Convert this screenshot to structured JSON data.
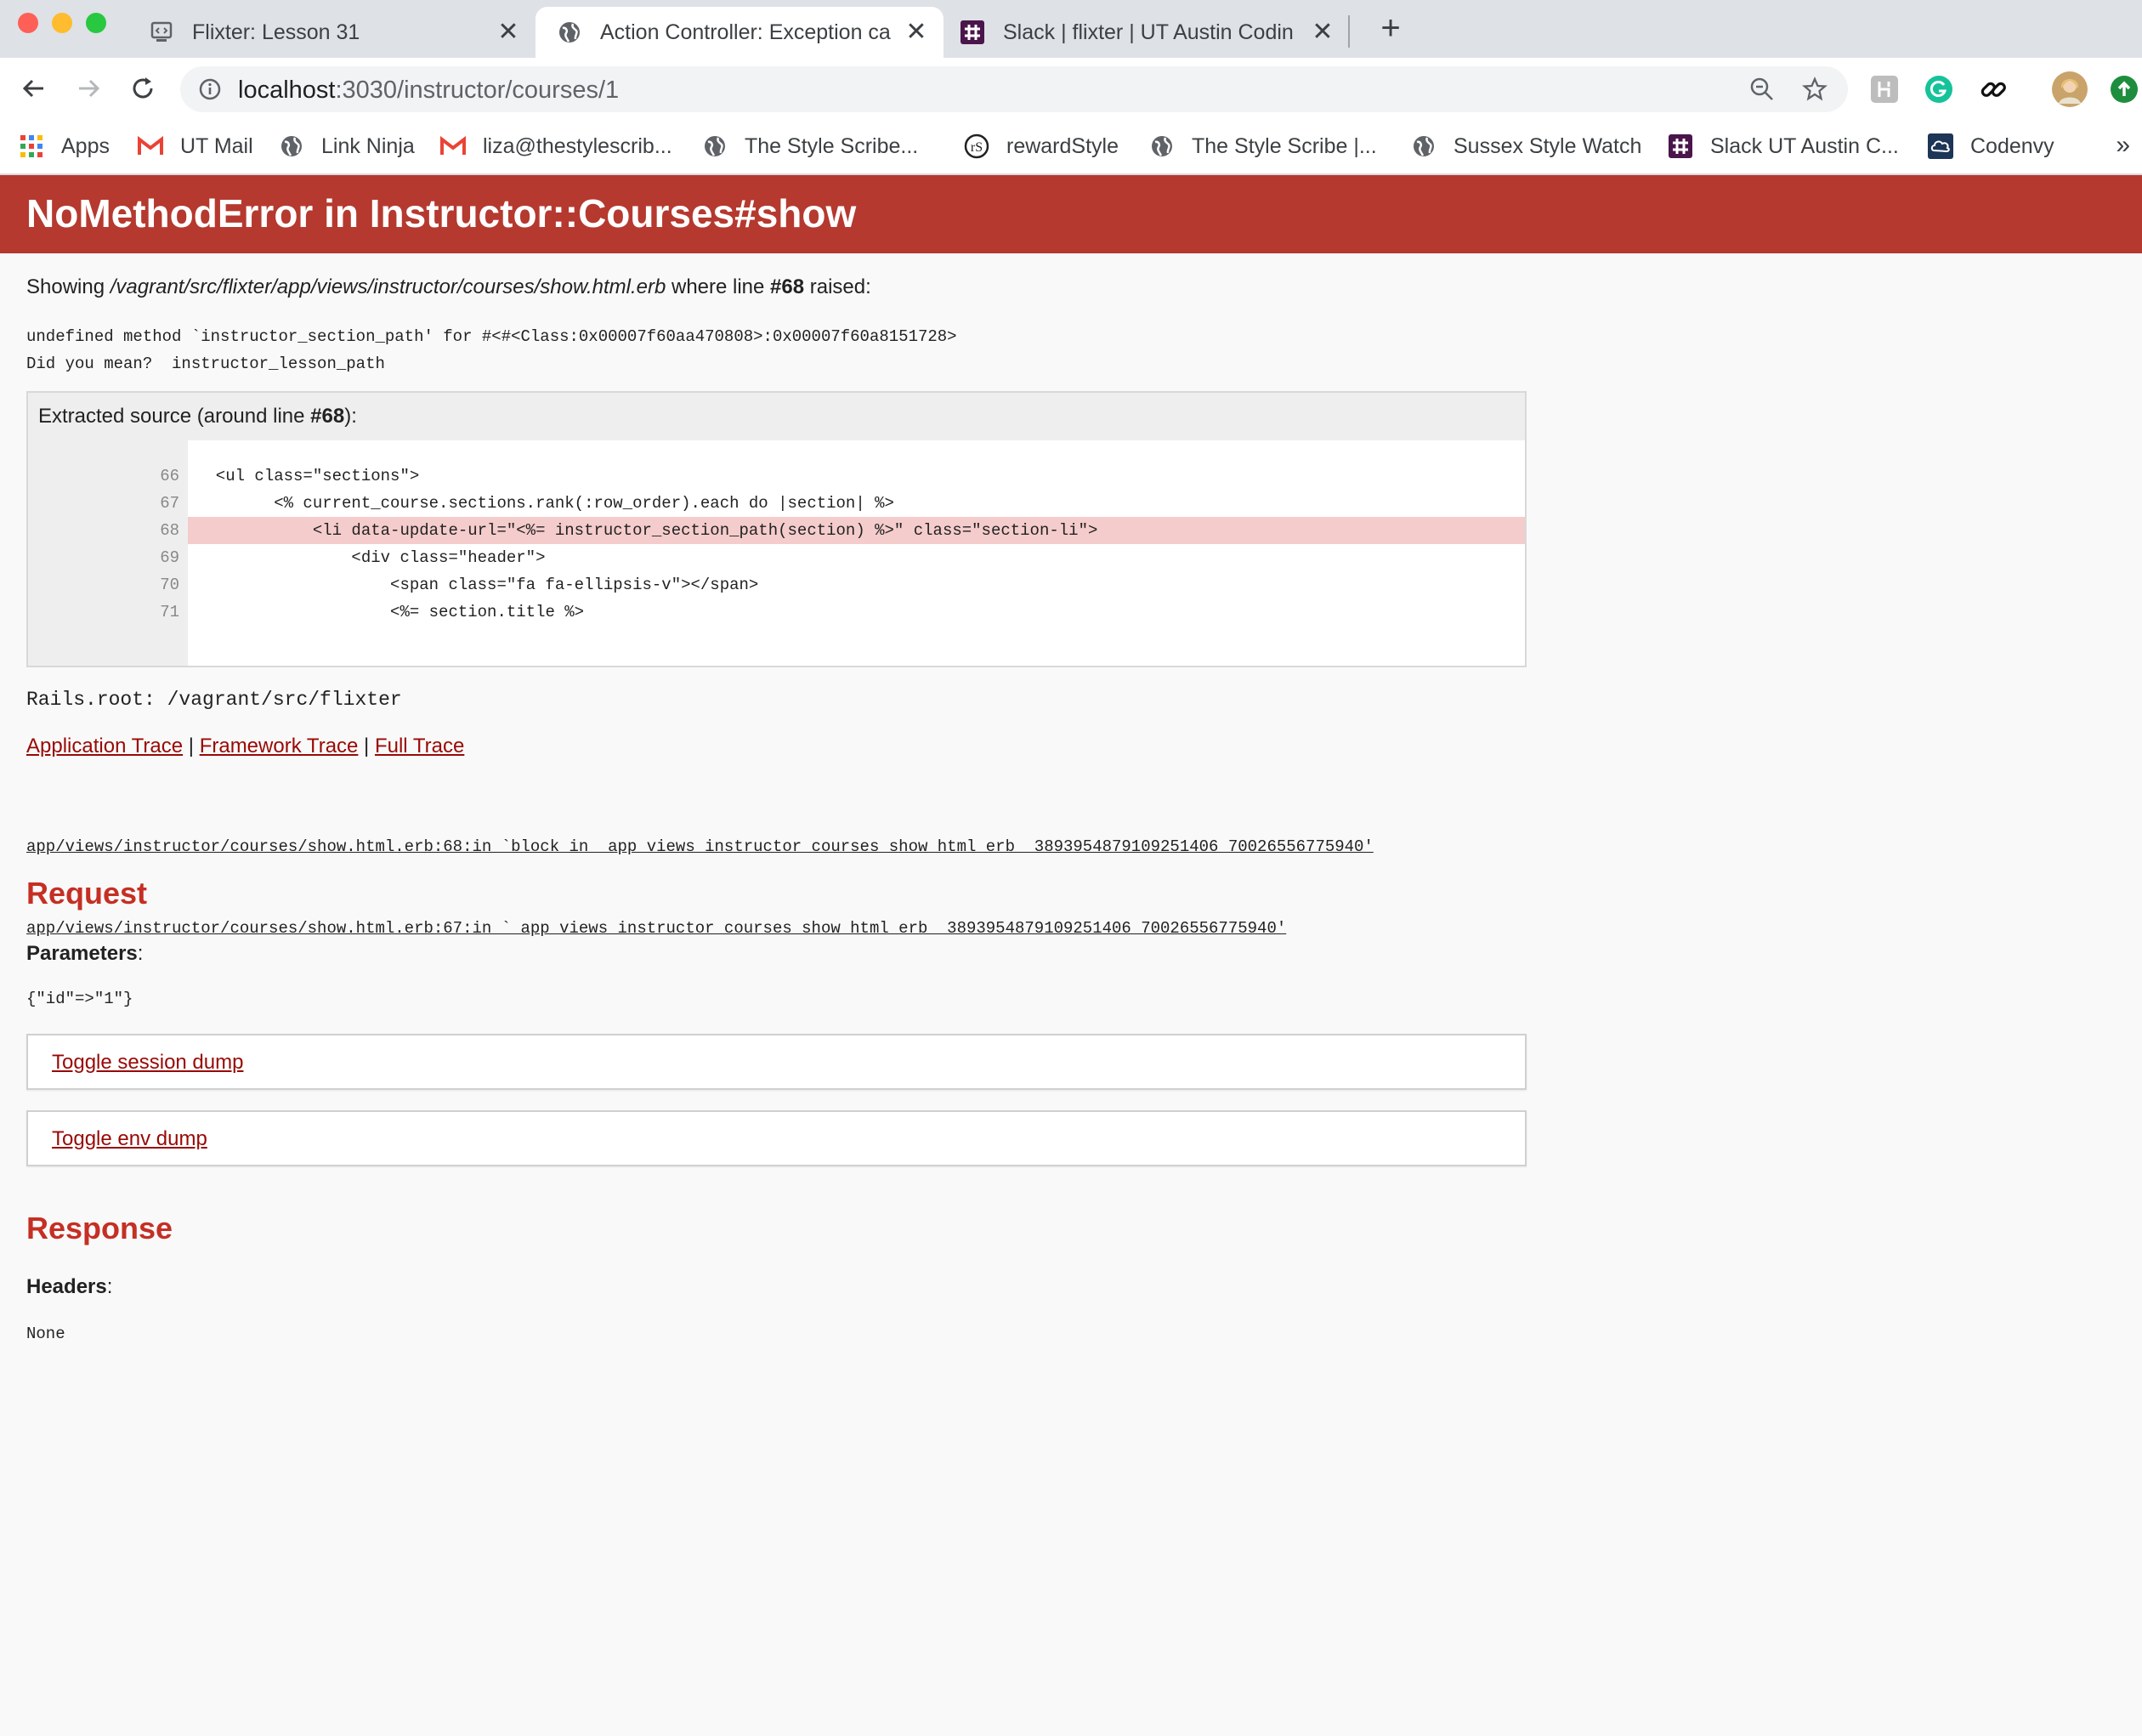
{
  "browser": {
    "tabs": [
      {
        "title": "Flixter: Lesson 31",
        "icon": "code-page-icon"
      },
      {
        "title": "Action Controller: Exception ca",
        "icon": "globe-icon",
        "active": true
      },
      {
        "title": "Slack | flixter | UT Austin Codin",
        "icon": "slack-icon"
      }
    ],
    "close_glyph": "✕",
    "new_tab_glyph": "+",
    "address": {
      "host": "localhost",
      "path": ":3030/instructor/courses/1"
    },
    "bookmarks": [
      {
        "label": "Apps",
        "icon": "apps-grid-icon"
      },
      {
        "label": "UT Mail",
        "icon": "gmail-icon"
      },
      {
        "label": "Link Ninja",
        "icon": "globe-icon"
      },
      {
        "label": "liza@thestylescrib...",
        "icon": "gmail-icon"
      },
      {
        "label": "The Style Scribe...",
        "icon": "globe-icon"
      },
      {
        "label": "rewardStyle",
        "icon": "rewardstyle-icon"
      },
      {
        "label": "The Style Scribe |...",
        "icon": "globe-icon"
      },
      {
        "label": "Sussex Style Watch",
        "icon": "globe-icon"
      },
      {
        "label": "Slack UT Austin C...",
        "icon": "slack-icon"
      },
      {
        "label": "Codenvy",
        "icon": "codenvy-icon"
      }
    ],
    "more_glyph": "»"
  },
  "error": {
    "title": "NoMethodError in Instructor::Courses#show",
    "showing_prefix": "Showing ",
    "file": "/vagrant/src/flixter/app/views/instructor/courses/show.html.erb",
    "where_text": " where line ",
    "line": "#68",
    "raised_text": " raised:",
    "message": "undefined method `instructor_section_path' for #<#<Class:0x00007f60aa470808>:0x00007f60a8151728>\nDid you mean?  instructor_lesson_path"
  },
  "source": {
    "header_prefix": "Extracted source (around line ",
    "header_line": "#68",
    "header_suffix": "):",
    "lines": [
      {
        "num": "66",
        "code": "  <ul class=\"sections\">"
      },
      {
        "num": "67",
        "code": "        <% current_course.sections.rank(:row_order).each do |section| %>"
      },
      {
        "num": "68",
        "code": "            <li data-update-url=\"<%= instructor_section_path(section) %>\" class=\"section-li\">"
      },
      {
        "num": "69",
        "code": "                <div class=\"header\">"
      },
      {
        "num": "70",
        "code": "                    <span class=\"fa fa-ellipsis-v\"></span>"
      },
      {
        "num": "71",
        "code": "                    <%= section.title %>"
      }
    ],
    "highlight": "68"
  },
  "rails_root": "Rails.root: /vagrant/src/flixter",
  "traces": {
    "application": "Application Trace",
    "framework": "Framework Trace",
    "full": "Full Trace",
    "separator": " | ",
    "entries": [
      "app/views/instructor/courses/show.html.erb:68:in `block in _app_views_instructor_courses_show_html_erb__3893954879109251406_70026556775940'",
      "app/views/instructor/courses/show.html.erb:67:in `_app_views_instructor_courses_show_html_erb__3893954879109251406_70026556775940'"
    ]
  },
  "request": {
    "title": "Request",
    "params_label": "Parameters",
    "colon": ":",
    "params_value": "{\"id\"=>\"1\"}",
    "toggle_session": "Toggle session dump",
    "toggle_env": "Toggle env dump"
  },
  "response": {
    "title": "Response",
    "headers_label": "Headers",
    "colon": ":",
    "headers_value": "None"
  },
  "colors": {
    "header_red": "#b5392f",
    "link_red": "#980905",
    "section_red": "#c52f24",
    "highlight": "#f5cccc"
  }
}
